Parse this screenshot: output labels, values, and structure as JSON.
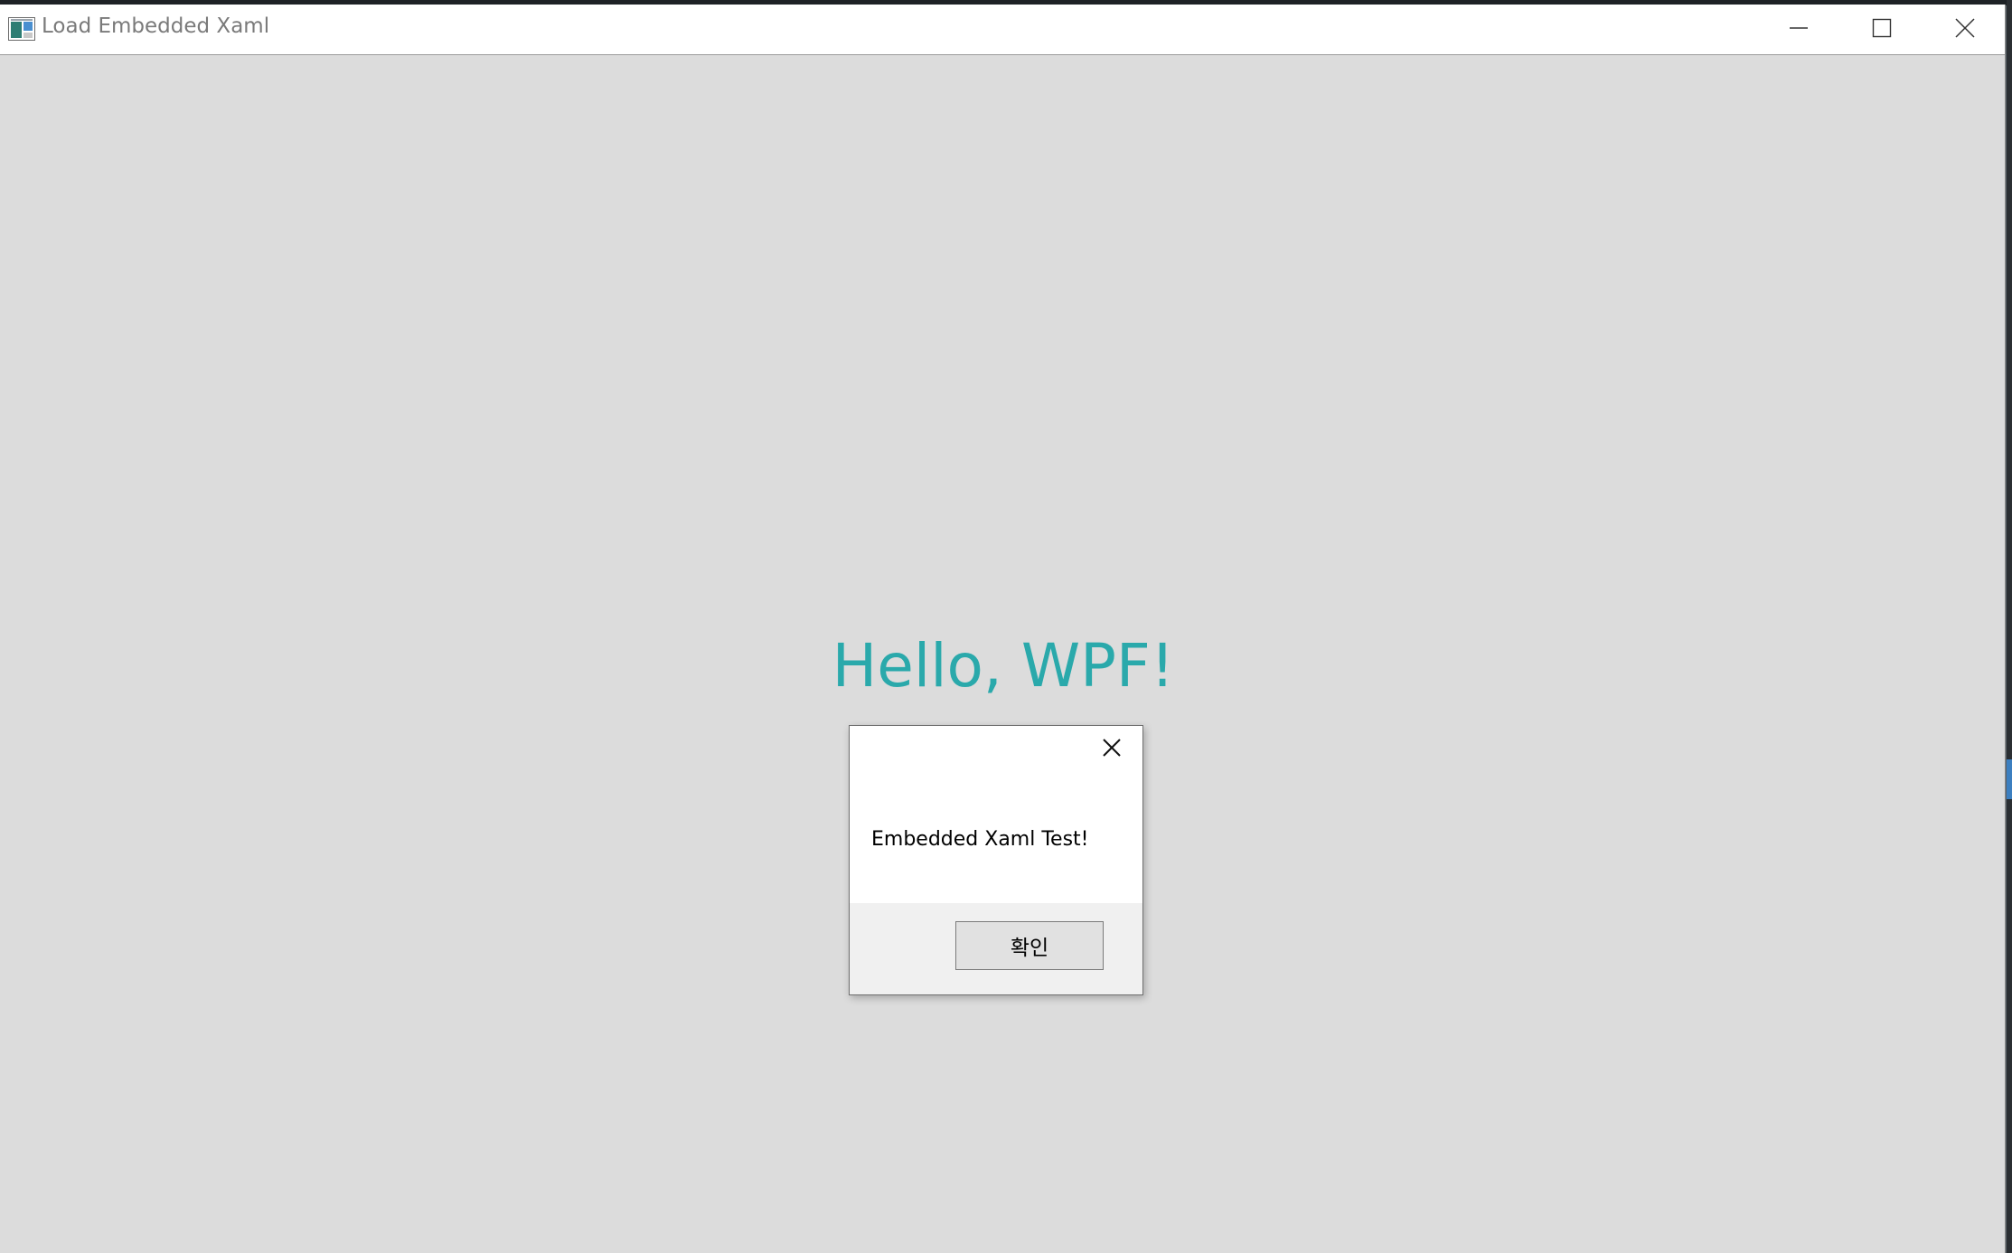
{
  "window": {
    "title": "Load Embedded Xaml",
    "controls": {
      "minimize_icon": "minimize-icon",
      "maximize_icon": "maximize-icon",
      "close_icon": "close-icon"
    }
  },
  "content": {
    "heading": "Hello, WPF!",
    "heading_color": "#2aa9ab",
    "background_color": "#dcdcdc"
  },
  "message_box": {
    "message": "Embedded Xaml Test!",
    "ok_label": "확인",
    "close_icon": "close-icon"
  }
}
